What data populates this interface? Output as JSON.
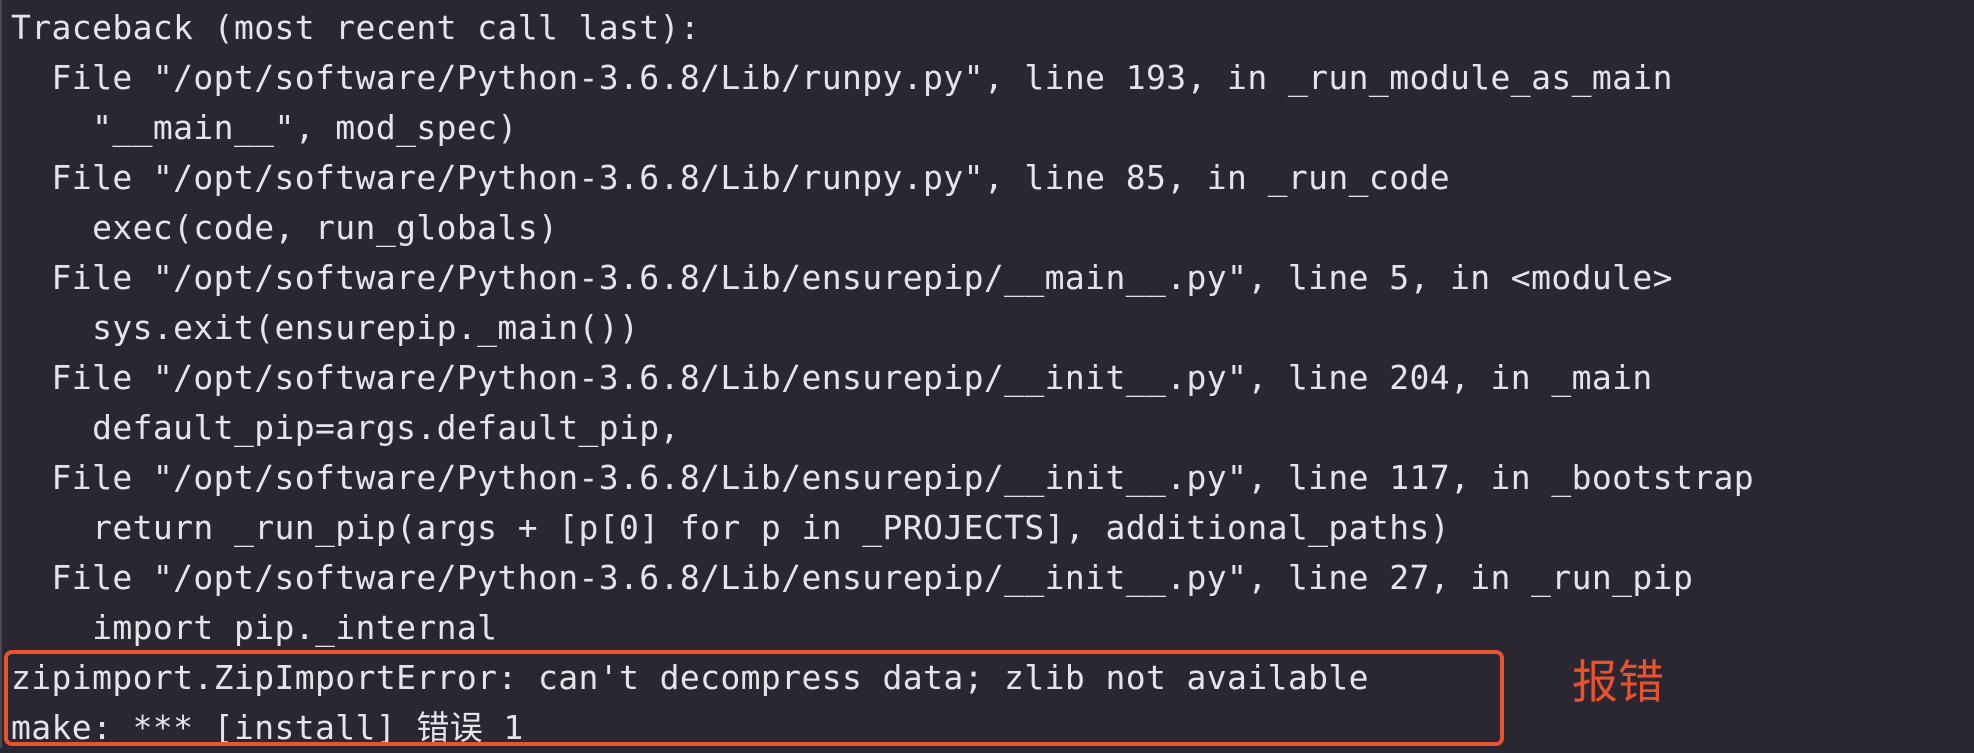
{
  "terminal": {
    "lines": [
      "Traceback (most recent call last):",
      "  File \"/opt/software/Python-3.6.8/Lib/runpy.py\", line 193, in _run_module_as_main",
      "    \"__main__\", mod_spec)",
      "  File \"/opt/software/Python-3.6.8/Lib/runpy.py\", line 85, in _run_code",
      "    exec(code, run_globals)",
      "  File \"/opt/software/Python-3.6.8/Lib/ensurepip/__main__.py\", line 5, in <module>",
      "    sys.exit(ensurepip._main())",
      "  File \"/opt/software/Python-3.6.8/Lib/ensurepip/__init__.py\", line 204, in _main",
      "    default_pip=args.default_pip,",
      "  File \"/opt/software/Python-3.6.8/Lib/ensurepip/__init__.py\", line 117, in _bootstrap",
      "    return _run_pip(args + [p[0] for p in _PROJECTS], additional_paths)",
      "  File \"/opt/software/Python-3.6.8/Lib/ensurepip/__init__.py\", line 27, in _run_pip",
      "    import pip._internal",
      "zipimport.ZipImportError: can't decompress data; zlib not available",
      "make: *** [install] 错误 1"
    ]
  },
  "annotation": {
    "label": "报错",
    "color": "#e8522c"
  }
}
